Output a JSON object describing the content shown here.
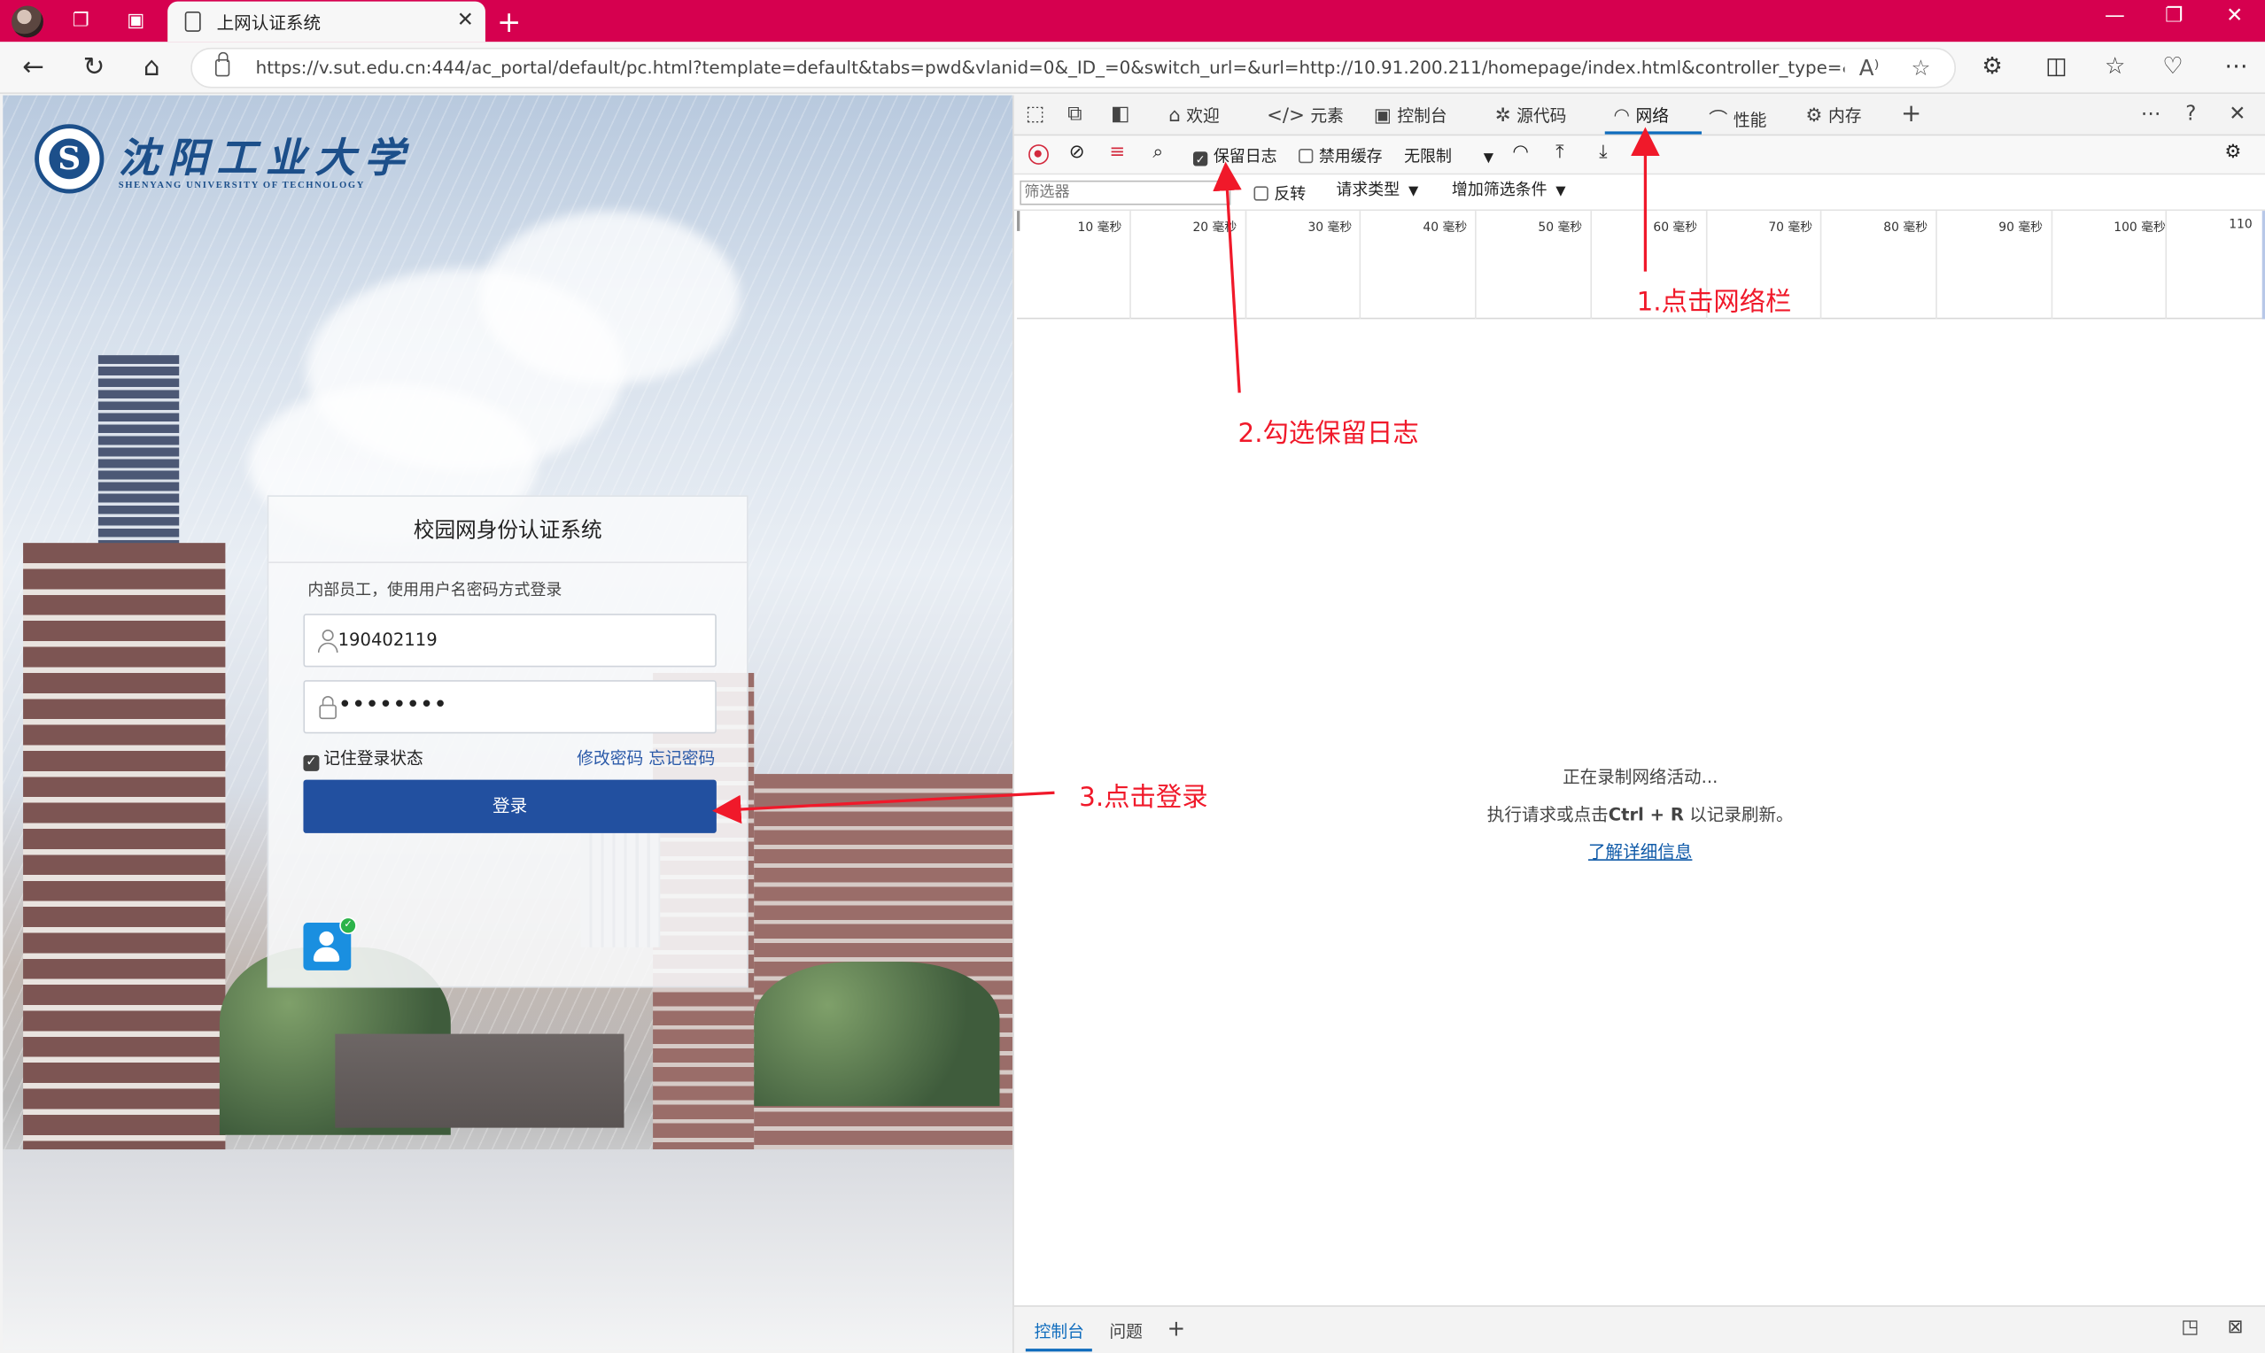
{
  "browser": {
    "tab_title": "上网认证系统",
    "url": "https://v.sut.edu.cn:444/ac_portal/default/pc.html?template=default&tabs=pwd&vlanid=0&_ID_=0&switch_url=&url=http://10.91.200.211/homepage/index.html&controller_type=&mac=48-7...",
    "accent_color": "#d6004f"
  },
  "page": {
    "logo_cn": "沈阳工业大学",
    "logo_en": "SHENYANG UNIVERSITY OF TECHNOLOGY",
    "card_title": "校园网身份认证系统",
    "hint": "内部员工，使用用户名密码方式登录",
    "username": "190402119",
    "password_mask": "••••••••",
    "remember_label": "记住登录状态",
    "change_password": "修改密码",
    "forgot_password": "忘记密码",
    "login_button": "登录",
    "button_color": "#2250a0"
  },
  "devtools": {
    "tabs": [
      "欢迎",
      "元素",
      "控制台",
      "源代码",
      "网络",
      "性能",
      "内存"
    ],
    "active_tab": "网络",
    "preserve_log": "保留日志",
    "disable_cache": "禁用缓存",
    "throttle": "无限制",
    "filter_placeholder": "筛选器",
    "invert": "反转",
    "request_types": "请求类型",
    "more_filters": "增加筛选条件",
    "timeline_labels": [
      "10 毫秒",
      "20 毫秒",
      "30 毫秒",
      "40 毫秒",
      "50 毫秒",
      "60 毫秒",
      "70 毫秒",
      "80 毫秒",
      "90 毫秒",
      "100 毫秒",
      "110"
    ],
    "empty_line1": "正在录制网络活动...",
    "empty_line2_pre": "执行请求或点击",
    "empty_line2_key": "Ctrl + R",
    "empty_line2_post": "以记录刷新。",
    "learn_more": "了解详细信息",
    "drawer_tabs": [
      "控制台",
      "问题"
    ]
  },
  "annotations": {
    "step1": "1.点击网络栏",
    "step2": "2.勾选保留日志",
    "step3": "3.点击登录"
  }
}
